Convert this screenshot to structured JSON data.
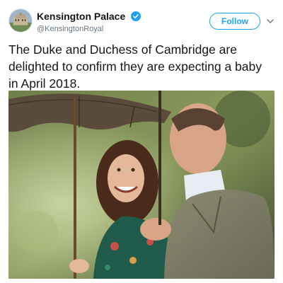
{
  "tweet": {
    "account": {
      "display_name": "Kensington Palace",
      "handle": "@KensingtonRoyal",
      "verified": true,
      "avatar_icon": "avatar-palace-icon"
    },
    "follow_label": "Follow",
    "menu_icon": "chevron-down-icon",
    "text": "The Duke and Duchess of Cambridge are delighted to confirm they are expecting a baby in April 2018.",
    "photo_icon": "photo-umbrella-couple"
  },
  "colors": {
    "accent": "#1da1f2",
    "text": "#14171a",
    "muted": "#657786"
  }
}
